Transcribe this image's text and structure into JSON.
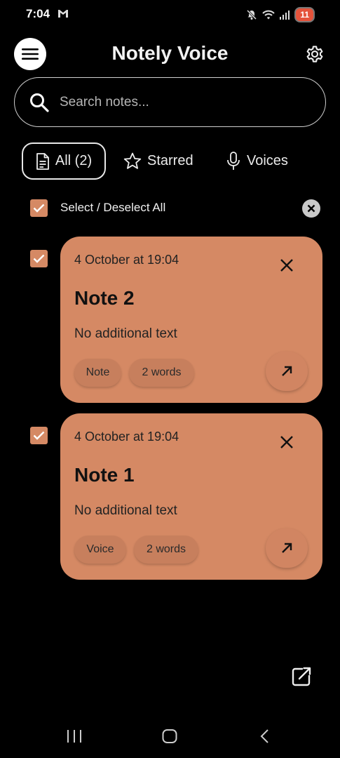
{
  "status_bar": {
    "time": "7:04",
    "battery": "11"
  },
  "header": {
    "title": "Notely Voice",
    "menu_icon": "hamburger-menu-icon",
    "settings_icon": "gear-icon"
  },
  "search": {
    "placeholder": "Search notes..."
  },
  "tabs": [
    {
      "label": "All (2)",
      "icon": "document-icon",
      "active": true
    },
    {
      "label": "Starred",
      "icon": "star-outline-icon",
      "active": false
    },
    {
      "label": "Voices",
      "icon": "microphone-icon",
      "active": false
    }
  ],
  "selection": {
    "label": "Select / Deselect All",
    "checked": true
  },
  "notes": [
    {
      "date": "4 October at 19:04",
      "title": "Note 2",
      "body": "No additional text",
      "type": "Note",
      "words": "2 words",
      "checked": true
    },
    {
      "date": "4 October at 19:04",
      "title": "Note 1",
      "body": "No additional text",
      "type": "Voice",
      "words": "2 words",
      "checked": true
    }
  ],
  "colors": {
    "background": "#000000",
    "accent": "#d58964",
    "chip": "#c77f5d",
    "text_dark": "#1a1a1a"
  }
}
